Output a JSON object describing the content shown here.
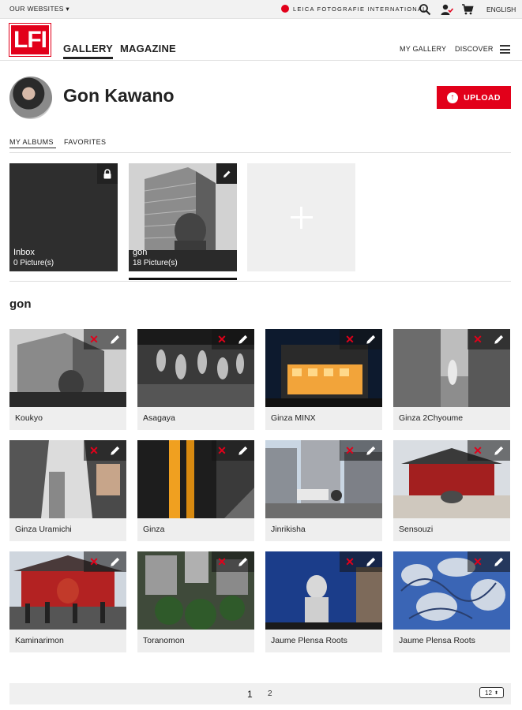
{
  "topbar": {
    "our_websites": "OUR WEBSITES ▾",
    "leica_label": "LEICA FOTOGRAFIE INTERNATIONAL",
    "language": "ENGLISH"
  },
  "header": {
    "logo": "LFI",
    "nav_gallery": "GALLERY",
    "nav_magazine": "MAGAZINE",
    "my_gallery": "MY GALLERY",
    "discover": "DISCOVER"
  },
  "profile": {
    "name": "Gon Kawano",
    "upload_label": "UPLOAD"
  },
  "tabs": {
    "my_albums": "MY ALBUMS",
    "favorites": "FAVORITES"
  },
  "albums": [
    {
      "title": "Inbox",
      "count": "0 Picture(s)"
    },
    {
      "title": "gon",
      "count": "18 Picture(s)"
    }
  ],
  "current_album": "gon",
  "photos": [
    {
      "caption": "Koukyo"
    },
    {
      "caption": "Asagaya"
    },
    {
      "caption": "Ginza MINX"
    },
    {
      "caption": "Ginza 2Chyoume"
    },
    {
      "caption": "Ginza Uramichi"
    },
    {
      "caption": "Ginza"
    },
    {
      "caption": "Jinrikisha"
    },
    {
      "caption": "Sensouzi"
    },
    {
      "caption": "Kaminarimon"
    },
    {
      "caption": "Toranomon"
    },
    {
      "caption": "Jaume Plensa Roots"
    },
    {
      "caption": "Jaume Plensa Roots"
    }
  ],
  "pagination": {
    "page1": "1",
    "page2": "2",
    "per_page": "12"
  },
  "colors": {
    "brand_red": "#e2001a"
  }
}
